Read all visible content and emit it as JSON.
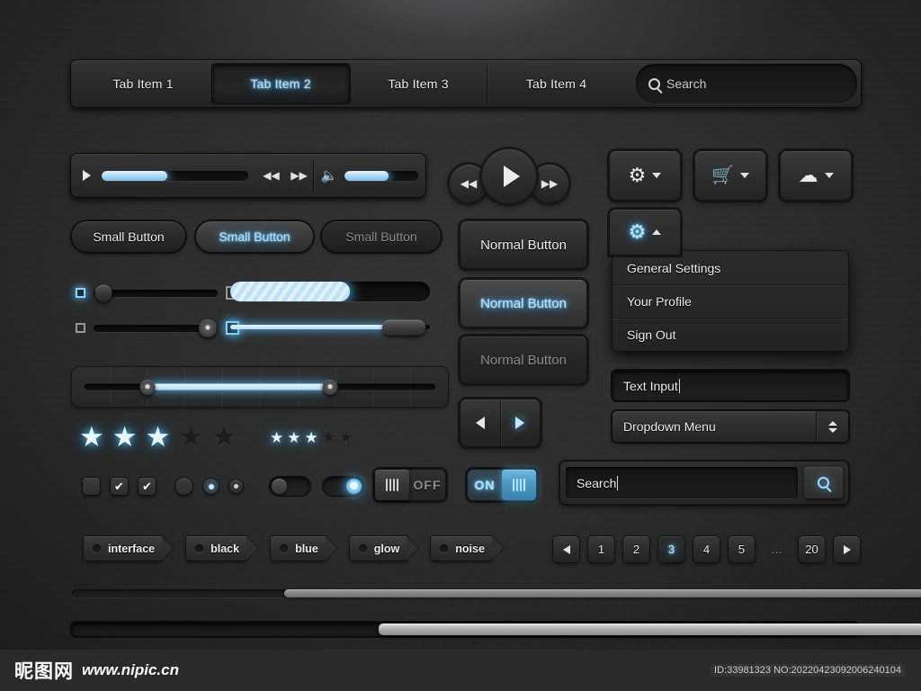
{
  "tabs": {
    "items": [
      {
        "label": "Tab Item 1",
        "state": "normal"
      },
      {
        "label": "Tab Item 2",
        "state": "active"
      },
      {
        "label": "Tab Item 3",
        "state": "normal"
      },
      {
        "label": "Tab Item 4",
        "state": "normal"
      }
    ],
    "search_placeholder": "Search",
    "search_icon": "search-icon"
  },
  "player": {
    "play_icon": "play-icon",
    "rewind_icon": "rewind-icon",
    "forward_icon": "fast-forward-icon",
    "volume_icon": "volume-icon",
    "progress_percent": 45,
    "volume_percent": 60
  },
  "transport": {
    "rewind_icon": "rewind-icon",
    "play_icon": "play-icon",
    "forward_icon": "fast-forward-icon"
  },
  "icon_buttons": [
    {
      "icon": "gear-icon",
      "caret": "chevron-down-icon",
      "state": "normal"
    },
    {
      "icon": "cart-icon",
      "caret": "chevron-down-icon",
      "state": "normal"
    },
    {
      "icon": "cloud-icon",
      "caret": "chevron-down-icon",
      "state": "normal"
    }
  ],
  "small_buttons": [
    {
      "label": "Small Button",
      "state": "normal"
    },
    {
      "label": "Small Button",
      "state": "active"
    },
    {
      "label": "Small Button",
      "state": "disabled"
    }
  ],
  "normal_buttons": [
    {
      "label": "Normal Button",
      "state": "normal"
    },
    {
      "label": "Normal Button",
      "state": "active"
    },
    {
      "label": "Normal Button",
      "state": "disabled"
    }
  ],
  "gear_menu": {
    "icon": "gear-icon",
    "caret": "chevron-up-icon",
    "items": [
      {
        "label": "General Settings"
      },
      {
        "label": "Your Profile"
      },
      {
        "label": "Sign Out"
      }
    ]
  },
  "text_input": {
    "value": "Text Input",
    "placeholder": "Text Input"
  },
  "dropdown": {
    "value": "Dropdown Menu",
    "stepper_icon": "stepper-updown-icon"
  },
  "search_widget": {
    "value": "Search",
    "placeholder": "Search",
    "button_icon": "search-icon"
  },
  "sliders": {
    "row1": {
      "left_box": "checked-lit",
      "right_box": "unlit",
      "value_percent": 8
    },
    "row2": {
      "left_box": "unlit",
      "right_box": "lit",
      "value_percent": 92
    },
    "big_progress_percent": 60,
    "thin_progress_percent": 87,
    "range": {
      "start_percent": 18,
      "end_percent": 70,
      "ticks": 9
    }
  },
  "stars": {
    "large": {
      "filled": 3,
      "total": 5
    },
    "small": {
      "filled": 3,
      "total": 5
    }
  },
  "checkboxes": [
    {
      "state": "unchecked",
      "mark": ""
    },
    {
      "state": "checked",
      "mark": "✔"
    },
    {
      "state": "checked",
      "mark": "✔"
    }
  ],
  "radios": [
    {
      "state": "unselected"
    },
    {
      "state": "selected-blue"
    },
    {
      "state": "selected-white"
    }
  ],
  "toggles": [
    {
      "state": "off"
    },
    {
      "state": "on"
    }
  ],
  "onoff_switches": [
    {
      "label": "OFF",
      "state": "off",
      "grip_icon": "grip-handle-icon"
    },
    {
      "label": "ON",
      "state": "on",
      "grip_icon": "grip-handle-icon"
    }
  ],
  "prev_next": {
    "prev_icon": "triangle-left-icon",
    "next_icon": "triangle-right-icon",
    "active": "next"
  },
  "tags": [
    {
      "label": "interface"
    },
    {
      "label": "black"
    },
    {
      "label": "blue"
    },
    {
      "label": "glow"
    },
    {
      "label": "noise"
    }
  ],
  "pagination": {
    "prev_icon": "triangle-left-icon",
    "next_icon": "triangle-right-icon",
    "pages": [
      "1",
      "2",
      "3",
      "4",
      "5",
      "…",
      "20"
    ],
    "current": "3"
  },
  "scrollbars": {
    "top": {
      "thumb_start_percent": 27,
      "thumb_width_percent": 85
    },
    "bottom": {
      "thumb_start_percent": 39,
      "thumb_width_percent": 73
    }
  },
  "footer": {
    "logo_cn": "昵图网",
    "url": "www.nipic.cn",
    "id_text": "ID:33981323 NO:20220423092006240104"
  },
  "colors": {
    "accent_glow": "#4fb2e8",
    "accent_text": "#b4e2ff",
    "bg": "#252525",
    "panel": "#2e2e2e",
    "text": "#efefef",
    "text_dim": "#8d8d8d"
  }
}
